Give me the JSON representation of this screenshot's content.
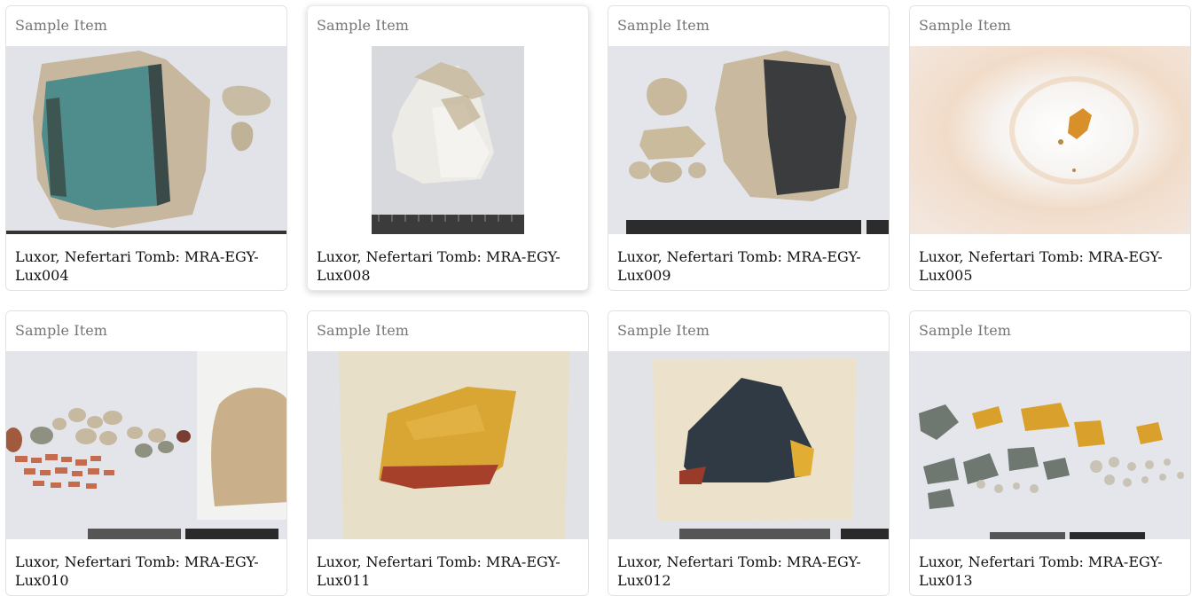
{
  "cards": [
    {
      "label": "Sample Item",
      "title": "Luxor, Nefertari Tomb: MRA-EGY-\nLux004",
      "image": "sample-photo-blue-fragment"
    },
    {
      "label": "Sample Item",
      "title": "Luxor, Nefertari Tomb: MRA-EGY-\nLux008",
      "image": "sample-photo-white-crystal"
    },
    {
      "label": "Sample Item",
      "title": "Luxor, Nefertari Tomb: MRA-EGY-\nLux009",
      "image": "sample-photo-black-fragment"
    },
    {
      "label": "Sample Item",
      "title": "Luxor, Nefertari Tomb: MRA-EGY-\nLux005",
      "image": "sample-photo-orange-speck"
    },
    {
      "label": "Sample Item",
      "title": "Luxor, Nefertari Tomb: MRA-EGY-\nLux010",
      "image": "sample-photo-pebbles"
    },
    {
      "label": "Sample Item",
      "title": "Luxor, Nefertari Tomb: MRA-EGY-\nLux011",
      "image": "sample-photo-yellow-on-cloth"
    },
    {
      "label": "Sample Item",
      "title": "Luxor, Nefertari Tomb: MRA-EGY-\nLux012",
      "image": "sample-photo-dark-on-cloth"
    },
    {
      "label": "Sample Item",
      "title": "Luxor, Nefertari Tomb: MRA-EGY-\nLux013",
      "image": "sample-photo-many-fragments"
    }
  ]
}
